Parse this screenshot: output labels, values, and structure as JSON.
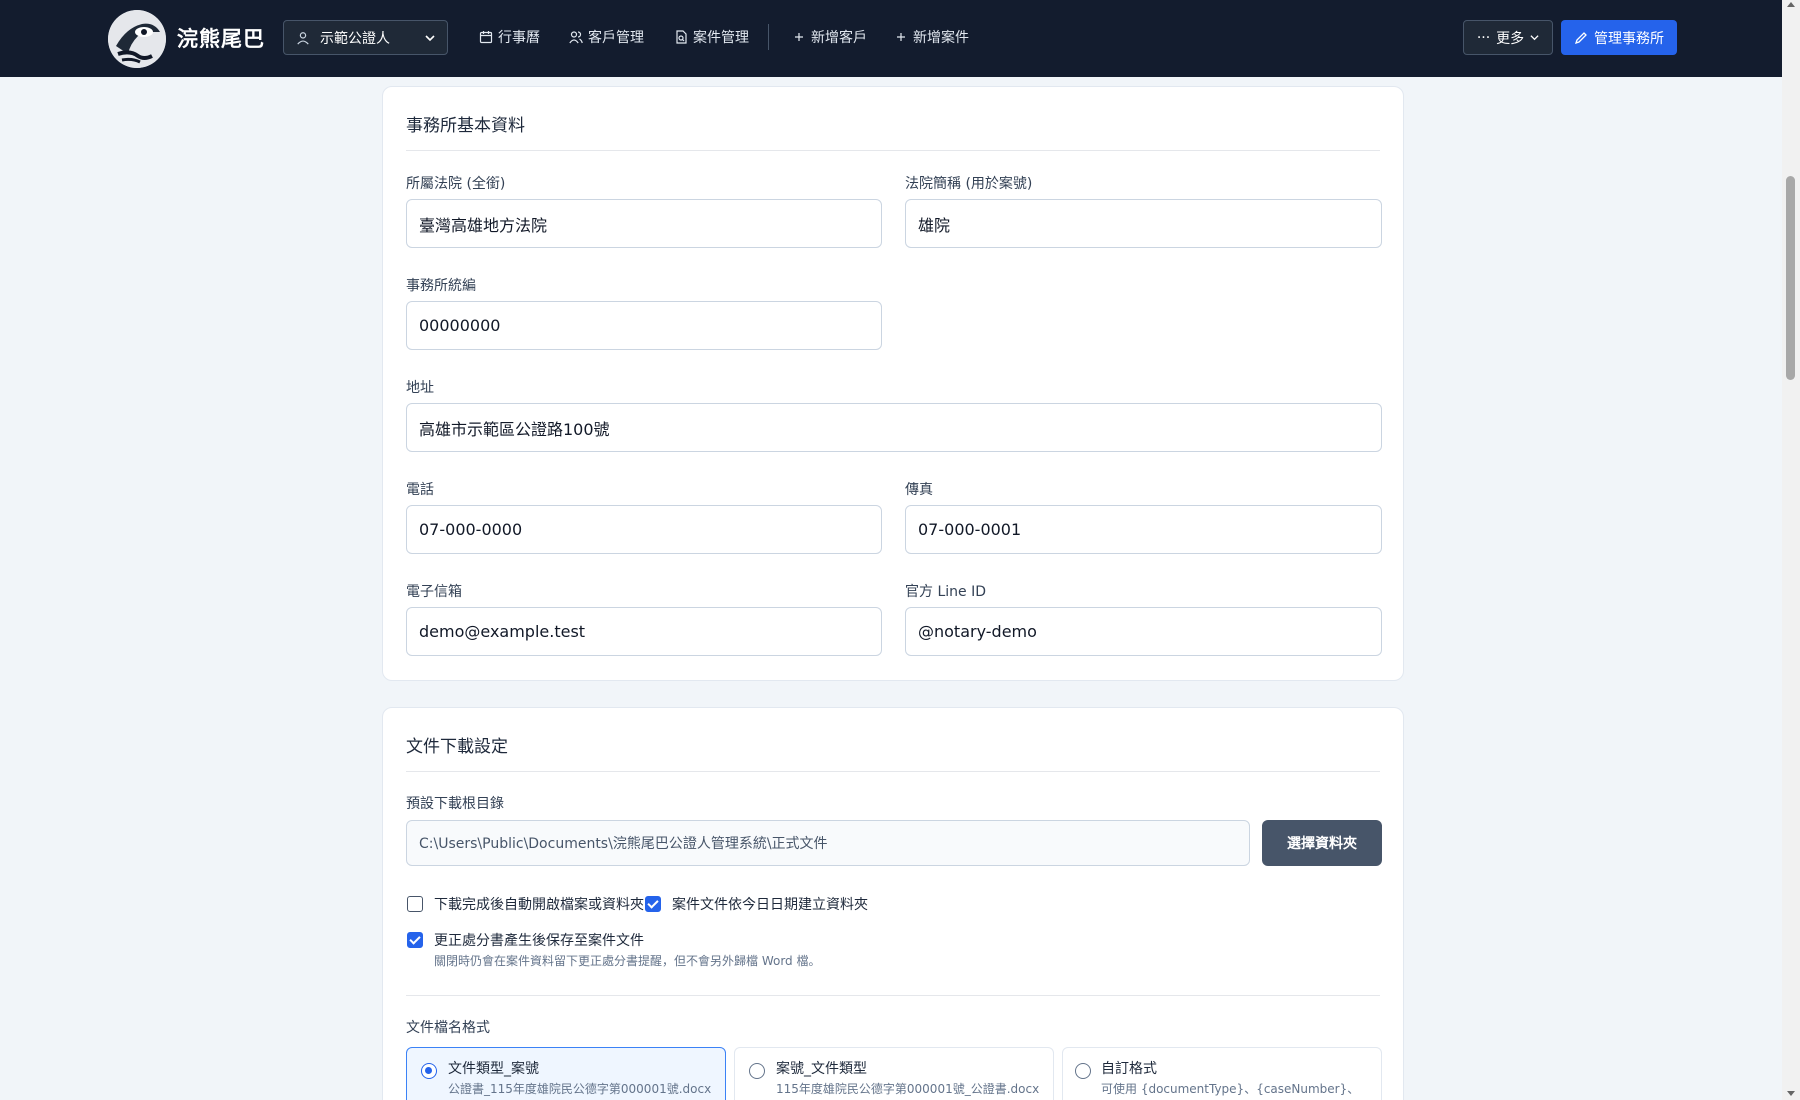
{
  "nav": {
    "brand": "浣熊尾巴",
    "user": "示範公證人",
    "links": [
      "行事曆",
      "客戶管理",
      "案件管理",
      "新增客戶",
      "新增案件"
    ],
    "more": "更多",
    "manage": "管理事務所"
  },
  "office": {
    "title": "事務所基本資料",
    "court_label": "所屬法院 (全銜)",
    "court_value": "臺灣高雄地方法院",
    "court_abbr_label": "法院簡稱 (用於案號)",
    "court_abbr_value": "雄院",
    "tax_id_label": "事務所統編",
    "tax_id_value": "00000000",
    "address_label": "地址",
    "address_value": "高雄市示範區公證路100號",
    "phone_label": "電話",
    "phone_value": "07-000-0000",
    "fax_label": "傳真",
    "fax_value": "07-000-0001",
    "email_label": "電子信箱",
    "email_value": "demo@example.test",
    "line_label": "官方 Line ID",
    "line_value": "@notary-demo"
  },
  "download": {
    "title": "文件下載設定",
    "root_label": "預設下載根目錄",
    "root_value": "C:\\Users\\Public\\Documents\\浣熊尾巴公證人管理系統\\正式文件",
    "folder_button": "選擇資料夾",
    "auto_open_label": "下載完成後自動開啟檔案或資料夾",
    "auto_open_checked": false,
    "date_folder_label": "案件文件依今日日期建立資料夾",
    "date_folder_checked": true,
    "save_correction_label": "更正處分書產生後保存至案件文件",
    "save_correction_checked": true,
    "save_correction_hint": "關閉時仍會在案件資料留下更正處分書提醒，但不會另外歸檔 Word 檔。",
    "filename_label": "文件檔名格式",
    "options": [
      {
        "title": "文件類型_案號",
        "sub": "公證書_115年度雄院民公德字第000001號.docx",
        "selected": true
      },
      {
        "title": "案號_文件類型",
        "sub": "115年度雄院民公德字第000001號_公證書.docx",
        "selected": false
      },
      {
        "title": "自訂格式",
        "sub": "可使用 {documentType}、{caseNumber}、",
        "selected": false
      }
    ]
  },
  "colors": {
    "nav_bg": "#131c2e",
    "primary": "#2563eb",
    "page_bg": "#f1f5f9"
  }
}
